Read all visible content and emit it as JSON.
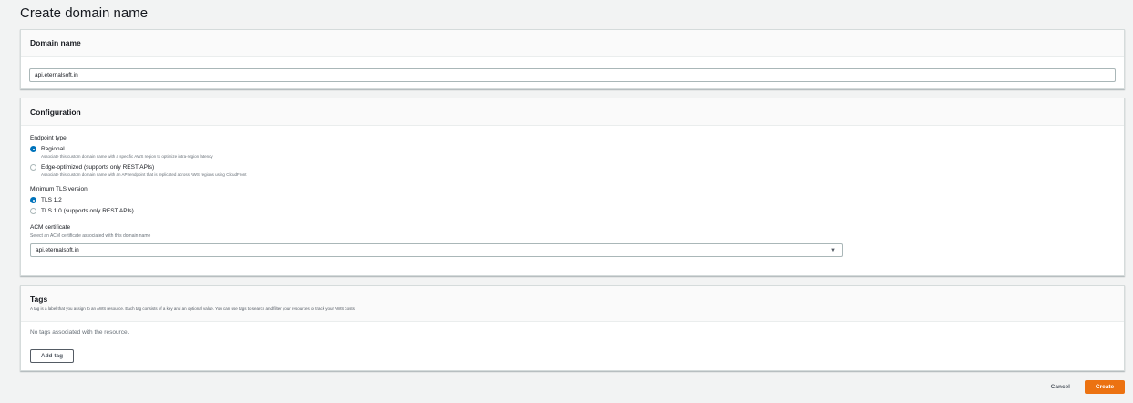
{
  "page": {
    "title": "Create domain name"
  },
  "domain_panel": {
    "title": "Domain name",
    "input_value": "api.eternalsoft.in"
  },
  "config_panel": {
    "title": "Configuration",
    "endpoint": {
      "label": "Endpoint type",
      "options": [
        {
          "label": "Regional",
          "desc": "Associate this custom domain name with a specific AWS region to optimize intra-region latency",
          "selected": true
        },
        {
          "label": "Edge-optimized (supports only REST APIs)",
          "desc": "Associate this custom domain name with an API endpoint that is replicated across AWS regions using CloudFront",
          "selected": false
        }
      ]
    },
    "tls": {
      "label": "Minimum TLS version",
      "options": [
        {
          "label": "TLS 1.2",
          "selected": true
        },
        {
          "label": "TLS 1.0 (supports only REST APIs)",
          "selected": false
        }
      ]
    },
    "acm": {
      "label": "ACM certificate",
      "desc": "Select an ACM certificate associated with this domain name",
      "selected_value": "api.eternalsoft.in"
    }
  },
  "tags_panel": {
    "title": "Tags",
    "desc": "A tag is a label that you assign to an AWS resource. Each tag consists of a key and an optional value. You can use tags to search and filter your resources or track your AWS costs.",
    "empty_text": "No tags associated with the resource.",
    "add_tag_label": "Add tag"
  },
  "footer": {
    "cancel_label": "Cancel",
    "create_label": "Create"
  },
  "colors": {
    "primary_button": "#ec7211",
    "radio_selected": "#0073bb",
    "background": "#f2f3f3"
  },
  "icons": {
    "dropdown": "caret-down-icon"
  }
}
